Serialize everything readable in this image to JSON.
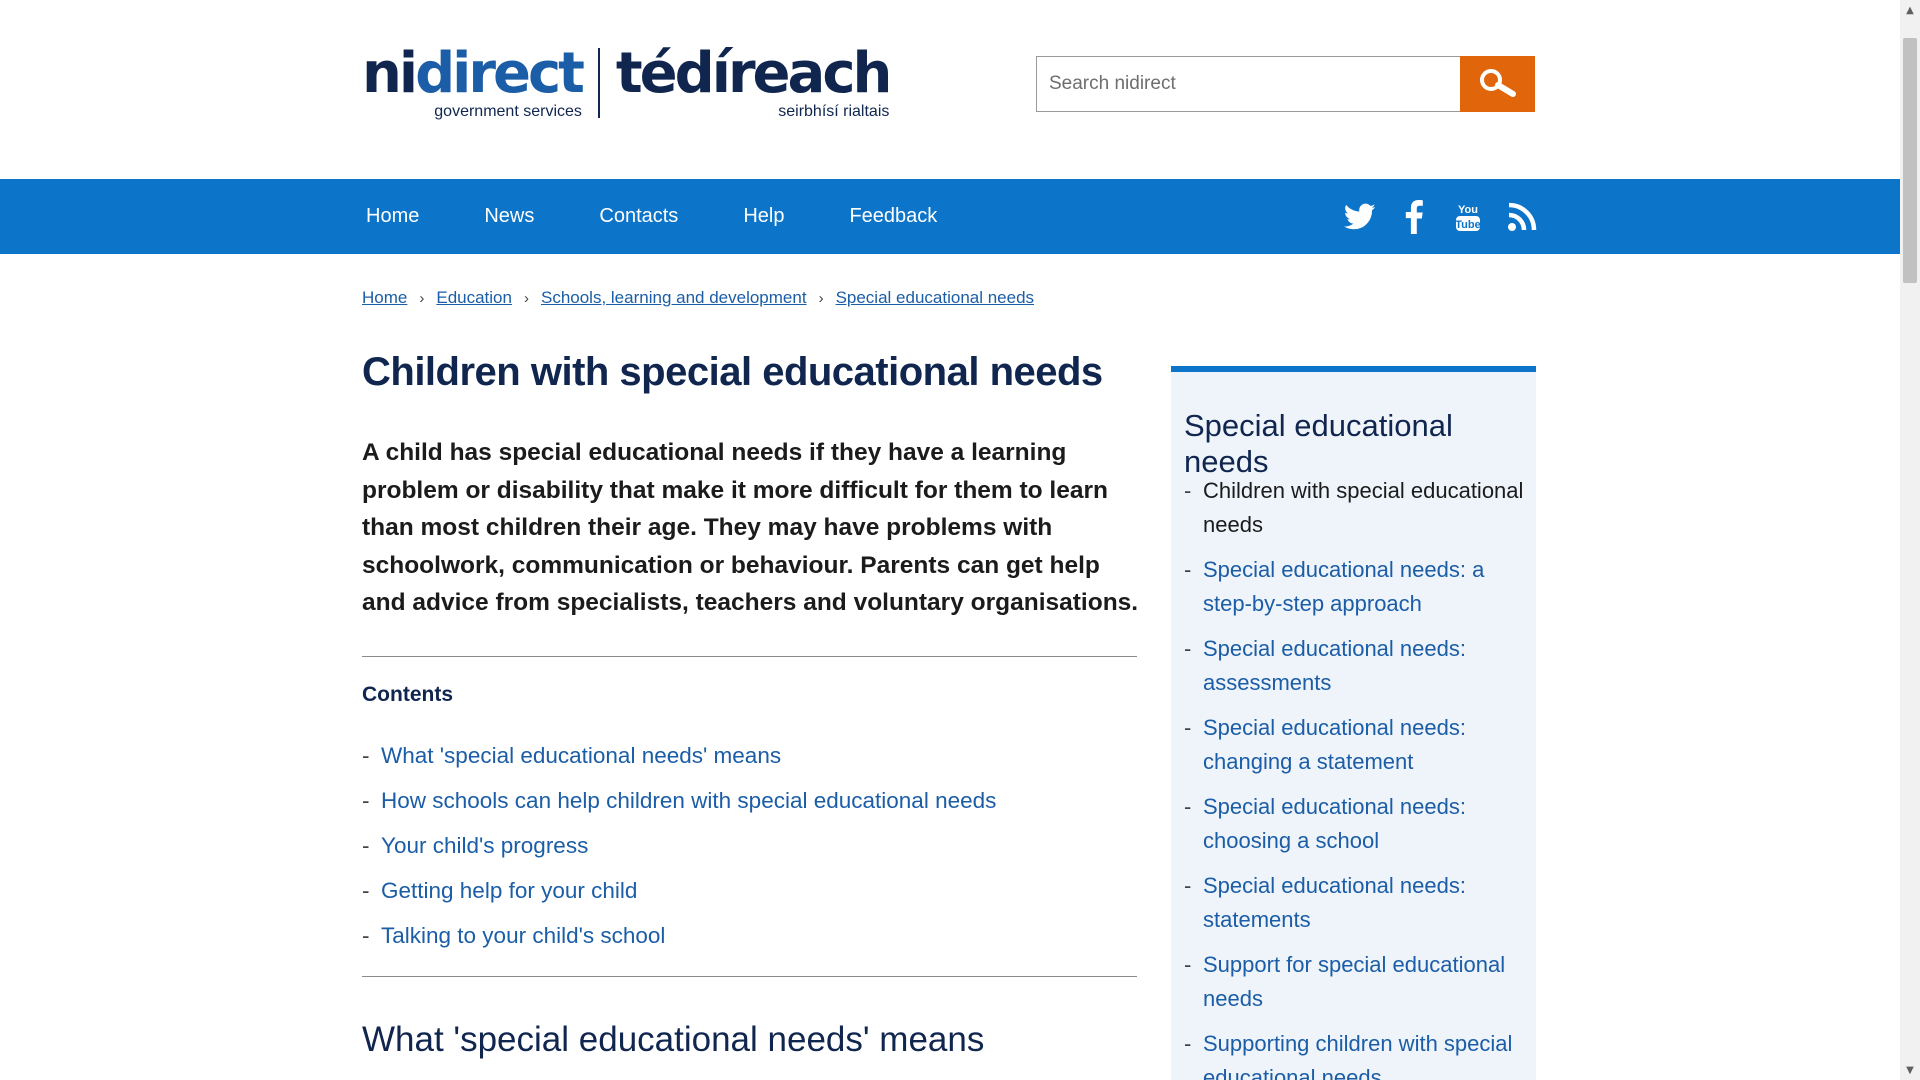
{
  "header": {
    "logo": {
      "en_prefix": "ni",
      "en_main": "direct",
      "en_tagline": "government services",
      "ga_main": "tédíreach",
      "ga_tagline": "seirbhísí rialtais"
    },
    "search": {
      "placeholder": "Search nidirect",
      "value": ""
    },
    "search_icon": "magnifier-icon"
  },
  "nav": {
    "items": [
      "Home",
      "News",
      "Contacts",
      "Help",
      "Feedback"
    ],
    "social": [
      "twitter-icon",
      "facebook-icon",
      "youtube-icon",
      "rss-icon"
    ]
  },
  "breadcrumb": [
    "Home",
    "Education",
    "Schools, learning and development",
    "Special educational needs"
  ],
  "main": {
    "title": "Children with special educational needs",
    "intro": "A child has special educational needs if they have a learning problem or disability that make it more difficult for them to learn than most children their age. They may have problems with schoolwork, communication or behaviour. Parents can get help and advice from specialists, teachers and voluntary organisations.",
    "contents_heading": "Contents",
    "contents": [
      "What 'special educational needs' means",
      "How schools can help children with special educational needs",
      "Your child's progress",
      "Getting help for your child",
      "Talking to your child's school"
    ],
    "dash": "-",
    "section_heading": "What 'special educational needs' means"
  },
  "sidebar": {
    "title": "Special educational needs",
    "items": [
      "Children with special educational needs",
      "Special educational needs: a step-by-step approach",
      "Special educational needs: assessments",
      "Special educational needs: changing a statement",
      "Special educational needs: choosing a school",
      "Special educational needs: statements",
      "Support for special educational needs",
      "Supporting children with special educational needs"
    ]
  },
  "colors": {
    "nav_bg": "#0c74c9",
    "search_button": "#e0650b",
    "link": "#1b5da6",
    "heading": "#10264f",
    "sidebar_bg": "#eef4fa"
  }
}
